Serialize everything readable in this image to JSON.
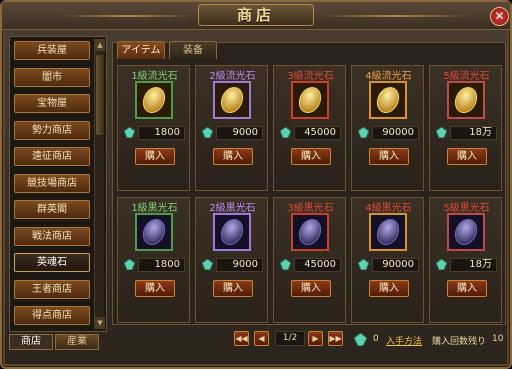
{
  "window": {
    "title": "商店",
    "close_symbol": "✕"
  },
  "sidebar": {
    "items": [
      {
        "label": "兵装屋"
      },
      {
        "label": "闇市"
      },
      {
        "label": "宝物屋"
      },
      {
        "label": "勢力商店"
      },
      {
        "label": "遠征商店"
      },
      {
        "label": "競技場商店"
      },
      {
        "label": "群英閣"
      },
      {
        "label": "戦法商店"
      },
      {
        "label": "英魂石"
      },
      {
        "label": "王者商店"
      },
      {
        "label": "得点商店"
      }
    ],
    "active_index": 8
  },
  "bottom_tabs": [
    {
      "label": "商店",
      "active": true
    },
    {
      "label": "産業",
      "active": false
    }
  ],
  "tabs": [
    {
      "label": "アイテム",
      "active": true
    },
    {
      "label": "装备",
      "active": false
    }
  ],
  "items_row1": [
    {
      "name": "1級流光石",
      "name_color": "#7fd07a",
      "price": "1800",
      "frame": "green",
      "gem_color": "#e6b840"
    },
    {
      "name": "2級流光石",
      "name_color": "#b98cf0",
      "price": "9000",
      "frame": "purple",
      "gem_color": "#e6b840"
    },
    {
      "name": "3級流光石",
      "name_color": "#e04838",
      "price": "45000",
      "frame": "red",
      "gem_color": "#e6b840"
    },
    {
      "name": "4級流光石",
      "name_color": "#f0a040",
      "price": "90000",
      "frame": "orange",
      "gem_color": "#e6b840"
    },
    {
      "name": "5級流光石",
      "name_color": "#e04838",
      "price": "18万",
      "frame": "purple2",
      "gem_color": "#e6b840"
    }
  ],
  "items_row2": [
    {
      "name": "1級黒光石",
      "name_color": "#7fd07a",
      "price": "1800",
      "frame": "green",
      "gem_color": "#5a5090"
    },
    {
      "name": "2級黒光石",
      "name_color": "#b98cf0",
      "price": "9000",
      "frame": "purple",
      "gem_color": "#5a5090"
    },
    {
      "name": "3級黒光石",
      "name_color": "#e04838",
      "price": "45000",
      "frame": "red",
      "gem_color": "#5a5090"
    },
    {
      "name": "4級黒光石",
      "name_color": "#e04838",
      "price": "90000",
      "frame": "orange",
      "gem_color": "#5a5090"
    },
    {
      "name": "5級黒光石",
      "name_color": "#e04838",
      "price": "18万",
      "frame": "purple2",
      "gem_color": "#5a5090"
    }
  ],
  "buy_label": "購入",
  "pager": {
    "first": "◀◀",
    "prev": "◀",
    "display": "1/2",
    "next": "▶",
    "last": "▶▶"
  },
  "footer": {
    "currency_amount": "0",
    "obtain_link": "入手方法",
    "remaining_label": "購入回数残り",
    "remaining_value": "10"
  },
  "colors": {
    "accent": "#c8803c",
    "link": "#f0c040"
  }
}
